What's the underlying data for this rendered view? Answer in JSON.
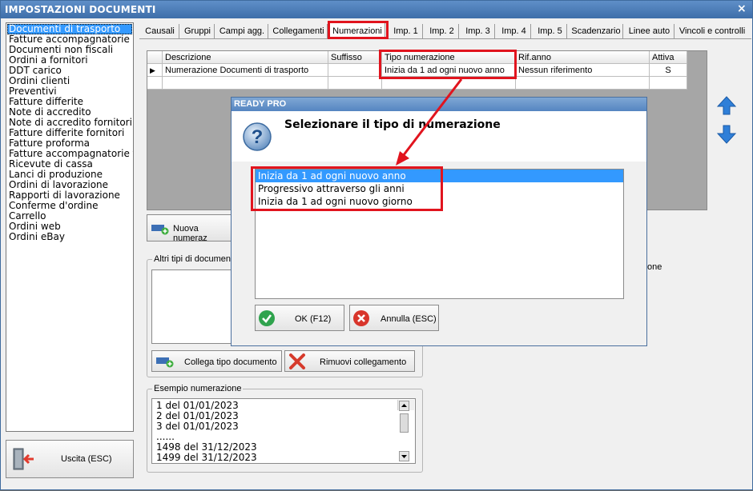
{
  "window": {
    "title": "IMPOSTAZIONI DOCUMENTI",
    "close_glyph": "×"
  },
  "sidebar": {
    "items": [
      "Documenti di trasporto",
      "Fatture accompagnatorie",
      "Documenti non fiscali",
      "Ordini a fornitori",
      "DDT carico",
      "Ordini clienti",
      "Preventivi",
      "Fatture differite",
      "Note di accredito",
      "Note di accredito fornitori",
      "Fatture differite fornitori",
      "Fatture proforma",
      "Fatture accompagnatorie fo",
      "Ricevute di cassa",
      "Lanci di produzione",
      "Ordini di lavorazione",
      "Rapporti di lavorazione",
      "Conferme d'ordine",
      "Carrello",
      "Ordini web",
      "Ordini eBay"
    ],
    "selected_index": 0
  },
  "exit_button": {
    "label": "Uscita (ESC)",
    "icon": "exit-door-icon"
  },
  "tabs": [
    "Causali",
    "Gruppi",
    "Campi agg.",
    "Collegamenti",
    "Numerazioni",
    "Imp. 1",
    "Imp. 2",
    "Imp. 3",
    "Imp. 4",
    "Imp. 5",
    "Scadenzario",
    "Linee auto",
    "Vincoli e controlli"
  ],
  "active_tab": "Numerazioni",
  "grid": {
    "columns": [
      "Descrizione",
      "Suffisso",
      "Tipo numerazione",
      "Rif.anno",
      "Attiva"
    ],
    "rows": [
      {
        "marker": "▶",
        "descrizione": "Numerazione Documenti di trasporto",
        "suffisso": "",
        "tipo": "Inizia da 1 ad ogni nuovo anno",
        "rif_anno": "Nessun riferimento",
        "attiva": "S"
      }
    ]
  },
  "buttons": {
    "nuova": "Nuova numeraz",
    "collega": "Collega tipo documento",
    "rimuovi": "Rimuovi collegamento"
  },
  "altri_tipi": {
    "label": "Altri tipi di document",
    "right_fragment": "one"
  },
  "esempio": {
    "label": "Esempio numerazione",
    "lines": [
      "1 del 01/01/2023",
      "2 del 01/01/2023",
      "3 del 01/01/2023",
      "......",
      "1498 del 31/12/2023",
      "1499 del 31/12/2023"
    ]
  },
  "dialog": {
    "title": "READY PRO",
    "message": "Selezionare il tipo di numerazione",
    "options": [
      "Inizia da 1 ad ogni nuovo anno",
      "Progressivo attraverso gli anni",
      "Inizia da 1 ad ogni nuovo giorno"
    ],
    "selected_index": 0,
    "ok_label": "OK (F12)",
    "cancel_label": "Annulla (ESC)"
  },
  "colors": {
    "highlight": "#e1141e",
    "selection": "#3399ff",
    "titlebar": "#3e6ea9"
  }
}
